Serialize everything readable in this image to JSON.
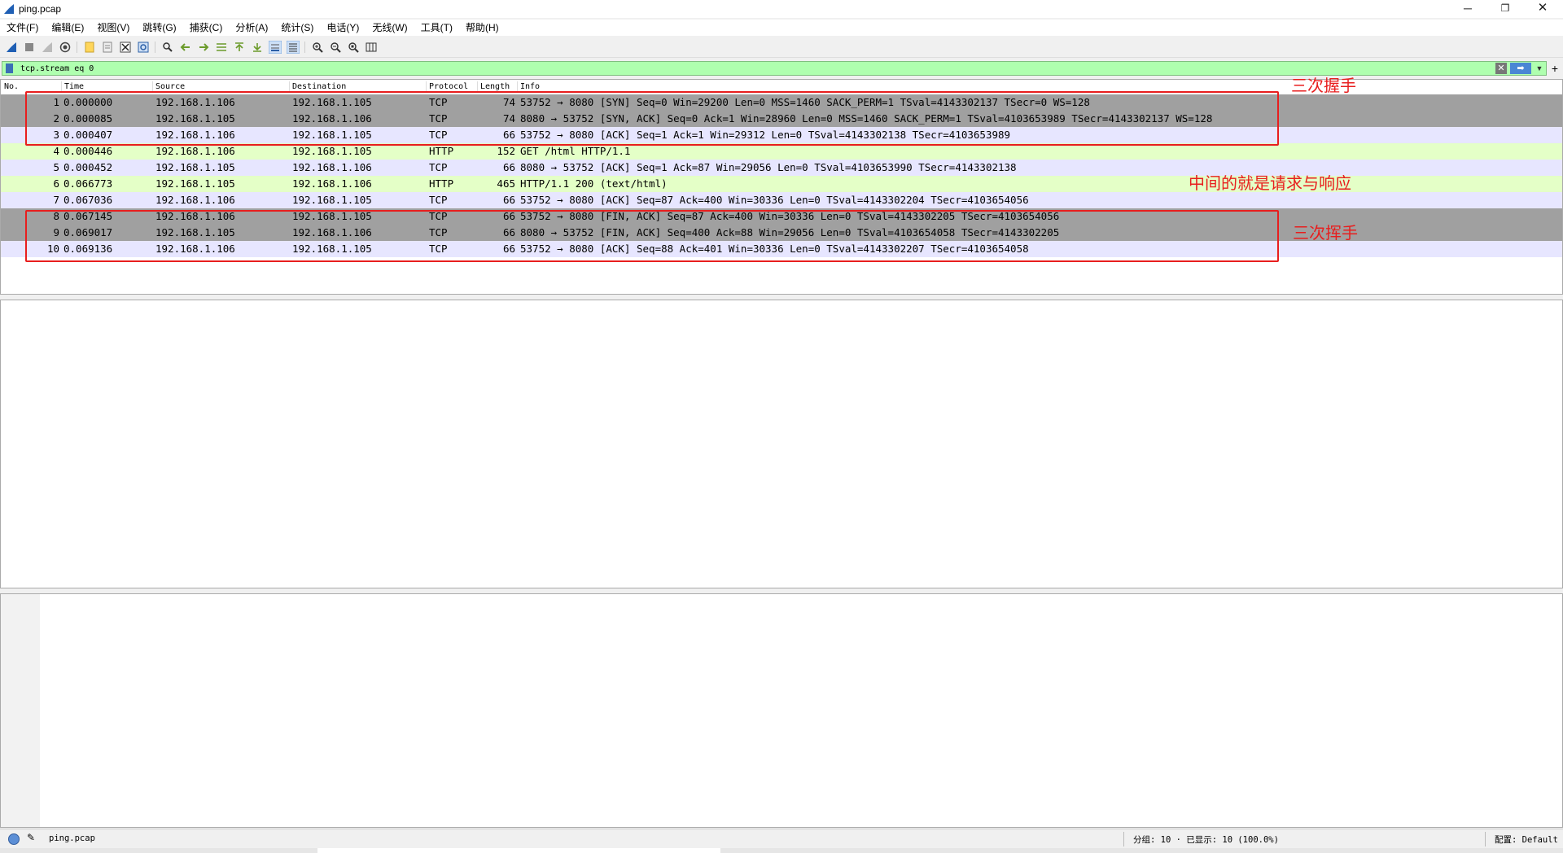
{
  "window": {
    "title": "ping.pcap",
    "min": "─",
    "max": "❐",
    "close": "✕"
  },
  "menu": [
    "文件(F)",
    "编辑(E)",
    "视图(V)",
    "跳转(G)",
    "捕获(C)",
    "分析(A)",
    "统计(S)",
    "电话(Y)",
    "无线(W)",
    "工具(T)",
    "帮助(H)"
  ],
  "filter": {
    "value": "tcp.stream eq 0",
    "apply_icon": "arrow-right-icon",
    "clear_icon": "clear-icon"
  },
  "columns": [
    "No.",
    "Time",
    "Source",
    "Destination",
    "Protocol",
    "Length",
    "Info"
  ],
  "colors": {
    "tcp_dark": "#a0a0a0",
    "tcp_light": "#e7e6ff",
    "http": "#e4ffc7",
    "annotation": "#e81e1e",
    "filter_bg": "#afffaf"
  },
  "packets": [
    {
      "no": "1",
      "time": "0.000000",
      "src": "192.168.1.106",
      "dst": "192.168.1.105",
      "proto": "TCP",
      "len": "74",
      "info": "53752 → 8080 [SYN] Seq=0 Win=29200 Len=0 MSS=1460 SACK_PERM=1 TSval=4143302137 TSecr=0 WS=128",
      "style": "dark"
    },
    {
      "no": "2",
      "time": "0.000085",
      "src": "192.168.1.105",
      "dst": "192.168.1.106",
      "proto": "TCP",
      "len": "74",
      "info": "8080 → 53752 [SYN, ACK] Seq=0 Ack=1 Win=28960 Len=0 MSS=1460 SACK_PERM=1 TSval=4103653989 TSecr=4143302137 WS=128",
      "style": "dark"
    },
    {
      "no": "3",
      "time": "0.000407",
      "src": "192.168.1.106",
      "dst": "192.168.1.105",
      "proto": "TCP",
      "len": "66",
      "info": "53752 → 8080 [ACK] Seq=1 Ack=1 Win=29312 Len=0 TSval=4143302138 TSecr=4103653989",
      "style": "light"
    },
    {
      "no": "4",
      "time": "0.000446",
      "src": "192.168.1.106",
      "dst": "192.168.1.105",
      "proto": "HTTP",
      "len": "152",
      "info": "GET /html HTTP/1.1",
      "style": "http"
    },
    {
      "no": "5",
      "time": "0.000452",
      "src": "192.168.1.105",
      "dst": "192.168.1.106",
      "proto": "TCP",
      "len": "66",
      "info": "8080 → 53752 [ACK] Seq=1 Ack=87 Win=29056 Len=0 TSval=4103653990 TSecr=4143302138",
      "style": "light"
    },
    {
      "no": "6",
      "time": "0.066773",
      "src": "192.168.1.105",
      "dst": "192.168.1.106",
      "proto": "HTTP",
      "len": "465",
      "info": "HTTP/1.1 200   (text/html)",
      "style": "http"
    },
    {
      "no": "7",
      "time": "0.067036",
      "src": "192.168.1.106",
      "dst": "192.168.1.105",
      "proto": "TCP",
      "len": "66",
      "info": "53752 → 8080 [ACK] Seq=87 Ack=400 Win=30336 Len=0 TSval=4143302204 TSecr=4103654056",
      "style": "light"
    },
    {
      "no": "8",
      "time": "0.067145",
      "src": "192.168.1.106",
      "dst": "192.168.1.105",
      "proto": "TCP",
      "len": "66",
      "info": "53752 → 8080 [FIN, ACK] Seq=87 Ack=400 Win=30336 Len=0 TSval=4143302205 TSecr=4103654056",
      "style": "dark"
    },
    {
      "no": "9",
      "time": "0.069017",
      "src": "192.168.1.105",
      "dst": "192.168.1.106",
      "proto": "TCP",
      "len": "66",
      "info": "8080 → 53752 [FIN, ACK] Seq=400 Ack=88 Win=29056 Len=0 TSval=4103654058 TSecr=4143302205",
      "style": "dark"
    },
    {
      "no": "10",
      "time": "0.069136",
      "src": "192.168.1.106",
      "dst": "192.168.1.105",
      "proto": "TCP",
      "len": "66",
      "info": "53752 → 8080 [ACK] Seq=88 Ack=401 Win=30336 Len=0 TSval=4143302207 TSecr=4103654058",
      "style": "light"
    }
  ],
  "annotations": {
    "handshake": "三次握手",
    "middle": "中间的就是请求与响应",
    "teardown": "三次挥手"
  },
  "status": {
    "file": "ping.pcap",
    "packets": "分组: 10 · 已显示: 10 (100.0%)",
    "profile": "配置: Default"
  }
}
